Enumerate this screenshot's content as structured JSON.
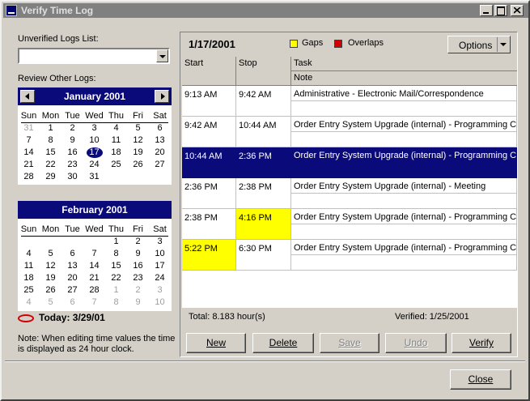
{
  "window": {
    "title": "Verify Time Log"
  },
  "left": {
    "unverified_label": "Unverified Logs List:",
    "unverified_value": "",
    "review_label": "Review Other Logs:",
    "today_label": "Today: 3/29/01",
    "note": "Note: When editing time values the time is displayed as 24 hour clock."
  },
  "calendars": [
    {
      "title": "January 2001",
      "dow": [
        "Sun",
        "Mon",
        "Tue",
        "Wed",
        "Thu",
        "Fri",
        "Sat"
      ],
      "weeks": [
        [
          "31",
          "1",
          "2",
          "3",
          "4",
          "5",
          "6"
        ],
        [
          "7",
          "8",
          "9",
          "10",
          "11",
          "12",
          "13"
        ],
        [
          "14",
          "15",
          "16",
          "17",
          "18",
          "19",
          "20"
        ],
        [
          "21",
          "22",
          "23",
          "24",
          "25",
          "26",
          "27"
        ],
        [
          "28",
          "29",
          "30",
          "31",
          "",
          "",
          ""
        ]
      ],
      "other_month": [
        [
          0,
          0
        ]
      ],
      "selected": [
        2,
        3
      ]
    },
    {
      "title": "February 2001",
      "dow": [
        "Sun",
        "Mon",
        "Tue",
        "Wed",
        "Thu",
        "Fri",
        "Sat"
      ],
      "weeks": [
        [
          "",
          "",
          "",
          "",
          "1",
          "2",
          "3"
        ],
        [
          "4",
          "5",
          "6",
          "7",
          "8",
          "9",
          "10"
        ],
        [
          "11",
          "12",
          "13",
          "14",
          "15",
          "16",
          "17"
        ],
        [
          "18",
          "19",
          "20",
          "21",
          "22",
          "23",
          "24"
        ],
        [
          "25",
          "26",
          "27",
          "28",
          "1",
          "2",
          "3"
        ],
        [
          "4",
          "5",
          "6",
          "7",
          "8",
          "9",
          "10"
        ]
      ],
      "other_month": [
        [
          4,
          4
        ],
        [
          4,
          5
        ],
        [
          4,
          6
        ],
        [
          5,
          0
        ],
        [
          5,
          1
        ],
        [
          5,
          2
        ],
        [
          5,
          3
        ],
        [
          5,
          4
        ],
        [
          5,
          5
        ],
        [
          5,
          6
        ]
      ],
      "selected": null
    }
  ],
  "log": {
    "date": "1/17/2001",
    "legend": [
      {
        "label": "Gaps",
        "color": "#ffff00"
      },
      {
        "label": "Overlaps",
        "color": "#d00000"
      }
    ],
    "options_label": "Options",
    "headers": {
      "start": "Start",
      "stop": "Stop",
      "task": "Task",
      "note": "Note"
    },
    "rows": [
      {
        "start": "9:13 AM",
        "stop": "9:42 AM",
        "task": "Administrative - Electronic Mail/Correspondence",
        "note": "",
        "selected": false,
        "start_gap": false,
        "stop_gap": false
      },
      {
        "start": "9:42 AM",
        "stop": "10:44 AM",
        "task": "Order Entry System Upgrade (internal) - Programming C++/",
        "note": "",
        "selected": false,
        "start_gap": false,
        "stop_gap": false
      },
      {
        "start": "10:44 AM",
        "stop": "2:36 PM",
        "task": "Order Entry System Upgrade (internal) - Programming C++/A",
        "note": "",
        "selected": true,
        "start_gap": false,
        "stop_gap": false
      },
      {
        "start": "2:36 PM",
        "stop": "2:38 PM",
        "task": "Order Entry System Upgrade (internal) - Meeting",
        "note": "",
        "selected": false,
        "start_gap": false,
        "stop_gap": false
      },
      {
        "start": "2:38 PM",
        "stop": "4:16 PM",
        "task": "Order Entry System Upgrade (internal) - Programming C++/",
        "note": "",
        "selected": false,
        "start_gap": false,
        "stop_gap": true
      },
      {
        "start": "5:22 PM",
        "stop": "6:30 PM",
        "task": "Order Entry System Upgrade (internal) - Programming C++/",
        "note": "",
        "selected": false,
        "start_gap": true,
        "stop_gap": false
      }
    ],
    "total": "Total: 8.183 hour(s)",
    "verified": "Verified: 1/25/2001"
  },
  "buttons": {
    "new": "New",
    "delete": "Delete",
    "save": "Save",
    "undo": "Undo",
    "verify": "Verify",
    "close": "Close"
  }
}
